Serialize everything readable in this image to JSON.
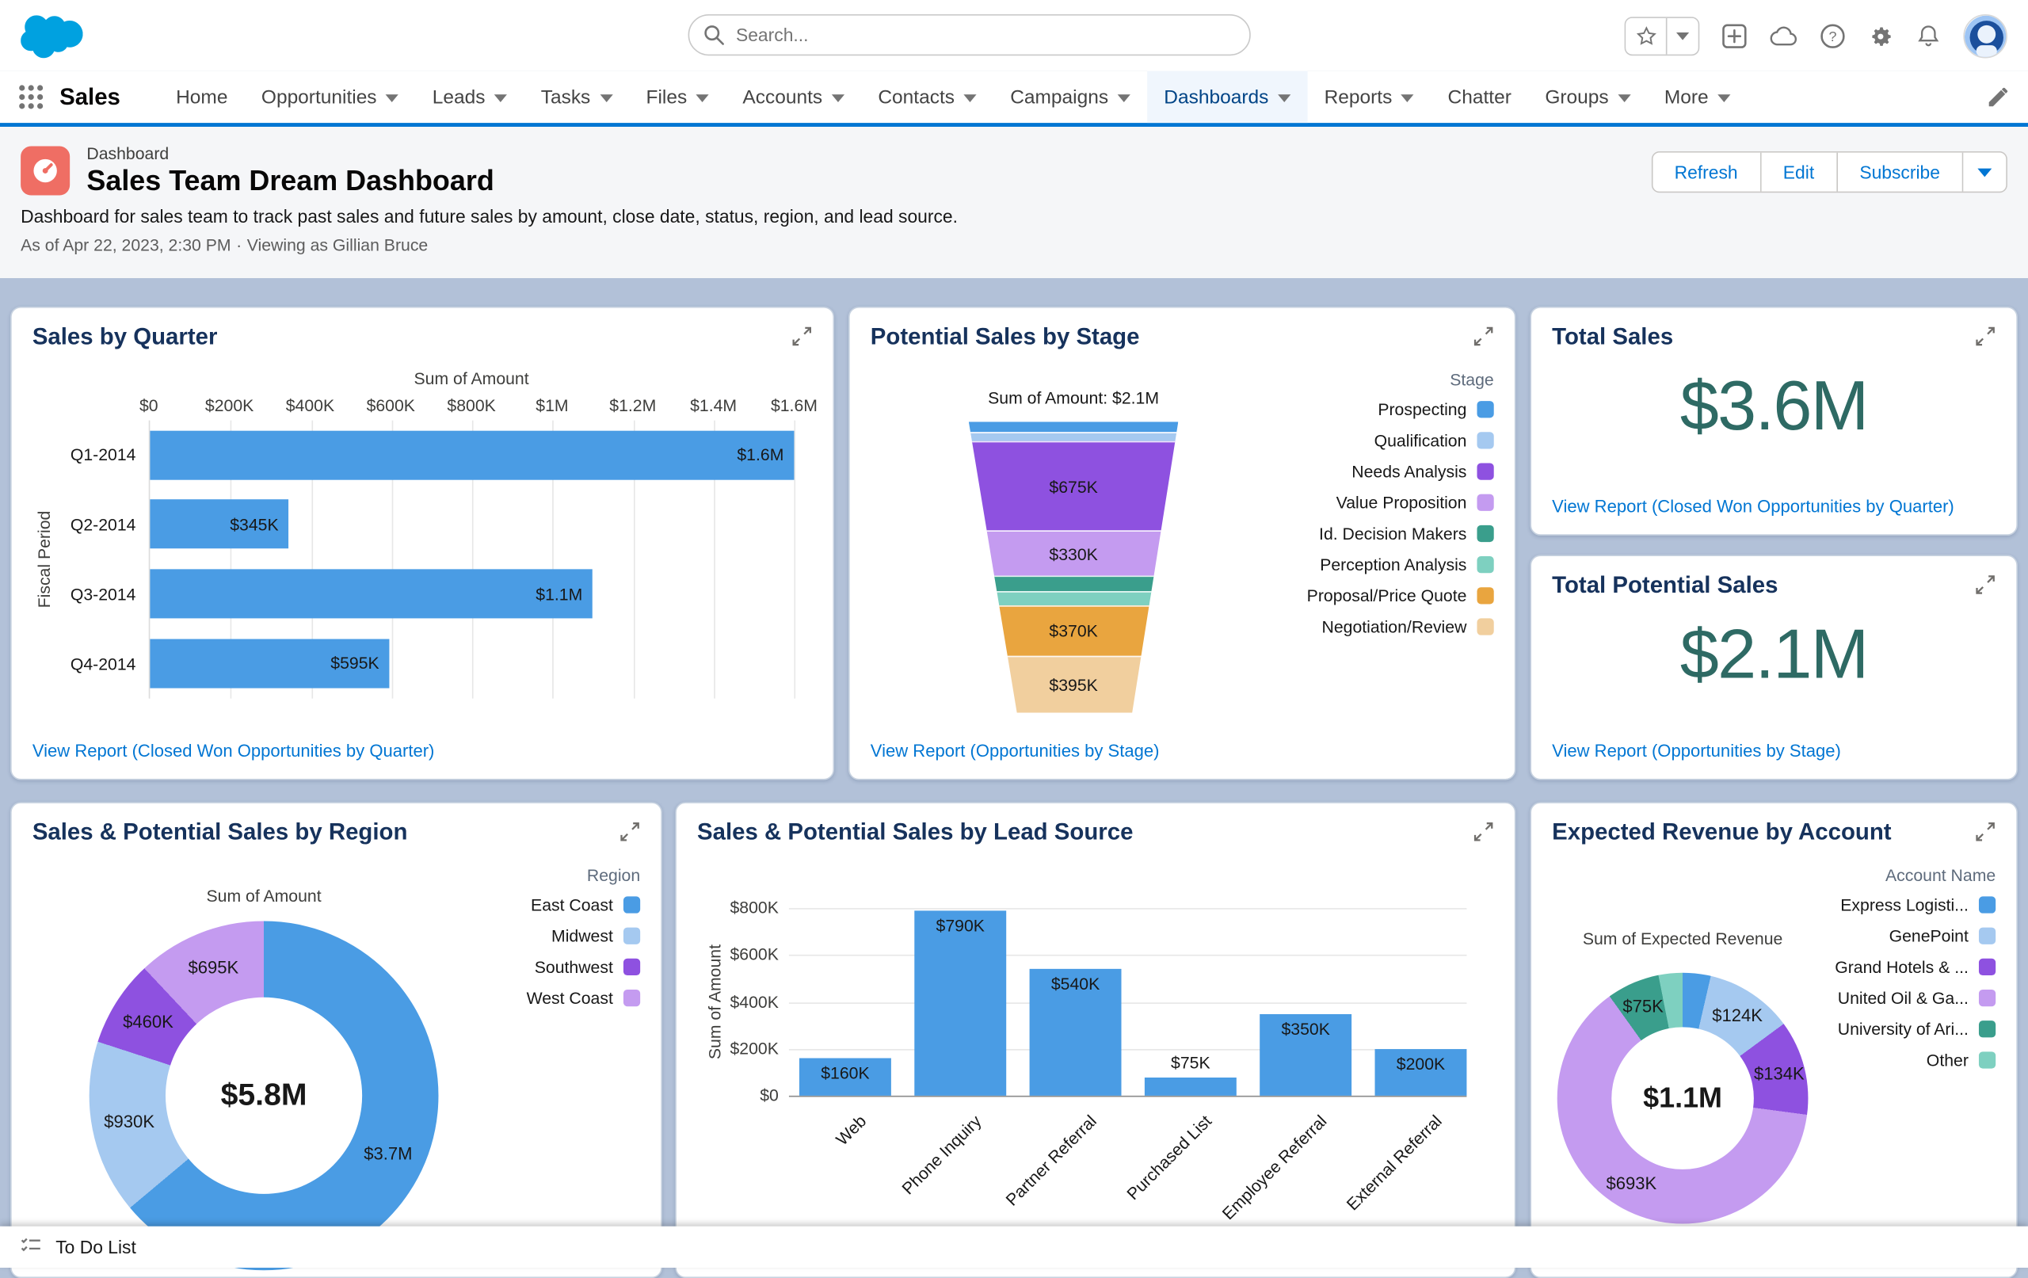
{
  "header": {
    "search_placeholder": "Search..."
  },
  "nav": {
    "app_name": "Sales",
    "items": [
      {
        "label": "Home",
        "caret": false
      },
      {
        "label": "Opportunities",
        "caret": true
      },
      {
        "label": "Leads",
        "caret": true
      },
      {
        "label": "Tasks",
        "caret": true
      },
      {
        "label": "Files",
        "caret": true
      },
      {
        "label": "Accounts",
        "caret": true
      },
      {
        "label": "Contacts",
        "caret": true
      },
      {
        "label": "Campaigns",
        "caret": true
      },
      {
        "label": "Dashboards",
        "caret": true,
        "active": true
      },
      {
        "label": "Reports",
        "caret": true
      },
      {
        "label": "Chatter",
        "caret": false
      },
      {
        "label": "Groups",
        "caret": true
      },
      {
        "label": "More",
        "caret": true
      }
    ]
  },
  "dashboard_header": {
    "type_label": "Dashboard",
    "title": "Sales Team Dream Dashboard",
    "description": "Dashboard for sales team to track past sales and future sales by amount, close date, status, region, and lead source.",
    "as_of": "As of Apr 22, 2023, 2:30 PM",
    "separator": "·",
    "viewing_as": "Viewing as Gillian Bruce",
    "buttons": {
      "refresh": "Refresh",
      "edit": "Edit",
      "subscribe": "Subscribe"
    }
  },
  "colors": {
    "brand_blue": "#0176D3",
    "canvas_bg": "#B2C1D8",
    "metric_teal": "#2E6A64",
    "link_blue": "#0176D3",
    "dashboard_icon_bg": "#EF6E64",
    "chart": {
      "blue": "#4A9CE4",
      "light_blue": "#A5C9F0",
      "purple": "#8E51E0",
      "light_purple": "#C49BF0",
      "teal": "#3A9E8C",
      "light_teal": "#7ED0C0",
      "orange": "#E9A53F",
      "tan": "#F1CF9E"
    }
  },
  "cards": {
    "sales_by_quarter": {
      "title": "Sales by Quarter",
      "view_report": "View Report (Closed Won Opportunities by Quarter)",
      "chart_data": {
        "type": "bar",
        "orientation": "horizontal",
        "xlabel": "Sum of Amount",
        "ylabel": "Fiscal Period",
        "x_ticks": [
          "$0",
          "$200K",
          "$400K",
          "$600K",
          "$800K",
          "$1M",
          "$1.2M",
          "$1.4M",
          "$1.6M"
        ],
        "xlim": [
          0,
          1600000
        ],
        "categories": [
          "Q1-2014",
          "Q2-2014",
          "Q3-2014",
          "Q4-2014"
        ],
        "values": [
          1600000,
          345000,
          1100000,
          595000
        ],
        "labels": [
          "$1.6M",
          "$345K",
          "$1.1M",
          "$595K"
        ]
      }
    },
    "potential_by_stage": {
      "title": "Potential Sales by Stage",
      "legend_title": "Stage",
      "view_report": "View Report (Opportunities by Stage)",
      "chart_data": {
        "type": "funnel",
        "total": "Sum of Amount: $2.1M",
        "segments": [
          {
            "stage": "Prospecting",
            "color_key": "blue",
            "label": "",
            "height_pct": 3.5
          },
          {
            "stage": "Qualification",
            "color_key": "light_blue",
            "label": "",
            "height_pct": 3
          },
          {
            "stage": "Needs Analysis",
            "color_key": "purple",
            "label": "$675K",
            "height_pct": 31
          },
          {
            "stage": "Value Proposition",
            "color_key": "light_purple",
            "label": "$330K",
            "height_pct": 15.5
          },
          {
            "stage": "Id. Decision Makers",
            "color_key": "teal",
            "label": "",
            "height_pct": 5
          },
          {
            "stage": "Perception Analysis",
            "color_key": "light_teal",
            "label": "",
            "height_pct": 5
          },
          {
            "stage": "Proposal/Price Quote",
            "color_key": "orange",
            "label": "$370K",
            "height_pct": 17.5
          },
          {
            "stage": "Negotiation/Review",
            "color_key": "tan",
            "label": "$395K",
            "height_pct": 19.5
          }
        ]
      }
    },
    "total_sales": {
      "title": "Total Sales",
      "metric": "$3.6M",
      "view_report": "View Report (Closed Won Opportunities by Quarter)"
    },
    "total_potential_sales": {
      "title": "Total Potential Sales",
      "metric": "$2.1M",
      "view_report": "View Report (Opportunities by Stage)"
    },
    "sales_by_region": {
      "title": "Sales & Potential Sales by Region",
      "legend_title": "Region",
      "chart_data": {
        "type": "donut",
        "measure_label": "Sum of Amount",
        "total_label": "$5.8M",
        "segments": [
          {
            "name": "East Coast",
            "color_key": "blue",
            "value": 3700000,
            "label": "$3.7M",
            "pct": 63.9
          },
          {
            "name": "Midwest",
            "color_key": "light_blue",
            "value": 930000,
            "label": "$930K",
            "pct": 16.1
          },
          {
            "name": "Southwest",
            "color_key": "purple",
            "value": 460000,
            "label": "$460K",
            "pct": 8.0
          },
          {
            "name": "West Coast",
            "color_key": "light_purple",
            "value": 695000,
            "label": "$695K",
            "pct": 12.0
          }
        ]
      }
    },
    "sales_by_lead_source": {
      "title": "Sales & Potential Sales by Lead Source",
      "chart_data": {
        "type": "bar",
        "orientation": "vertical",
        "ylabel": "Sum of Amount",
        "y_ticks": [
          "$800K",
          "$600K",
          "$400K",
          "$200K",
          "$0"
        ],
        "ylim": [
          0,
          800000
        ],
        "categories": [
          "Web",
          "Phone Inquiry",
          "Partner Referral",
          "Purchased List",
          "Employee Referral",
          "External Referral"
        ],
        "values": [
          160000,
          790000,
          540000,
          75000,
          350000,
          200000
        ],
        "labels": [
          "$160K",
          "$790K",
          "$540K",
          "$75K",
          "$350K",
          "$200K"
        ]
      }
    },
    "expected_revenue_by_account": {
      "title": "Expected Revenue by Account",
      "legend_title": "Account Name",
      "chart_data": {
        "type": "donut",
        "measure_label": "Sum of Expected Revenue",
        "total_label": "$1.1M",
        "segments": [
          {
            "name": "Express Logisti...",
            "color_key": "blue",
            "label": "",
            "pct": 3.6
          },
          {
            "name": "GenePoint",
            "color_key": "light_blue",
            "value": 124000,
            "label": "$124K",
            "pct": 11.3
          },
          {
            "name": "Grand Hotels & ...",
            "color_key": "purple",
            "value": 134000,
            "label": "$134K",
            "pct": 12.2
          },
          {
            "name": "United Oil & Ga...",
            "color_key": "light_purple",
            "value": 693000,
            "label": "$693K",
            "pct": 63.0
          },
          {
            "name": "University of Ari...",
            "color_key": "teal",
            "value": 75000,
            "label": "$75K",
            "pct": 6.8
          },
          {
            "name": "Other",
            "color_key": "light_teal",
            "label": "",
            "pct": 3.1
          }
        ]
      }
    }
  },
  "footer": {
    "todo_label": "To Do List"
  }
}
